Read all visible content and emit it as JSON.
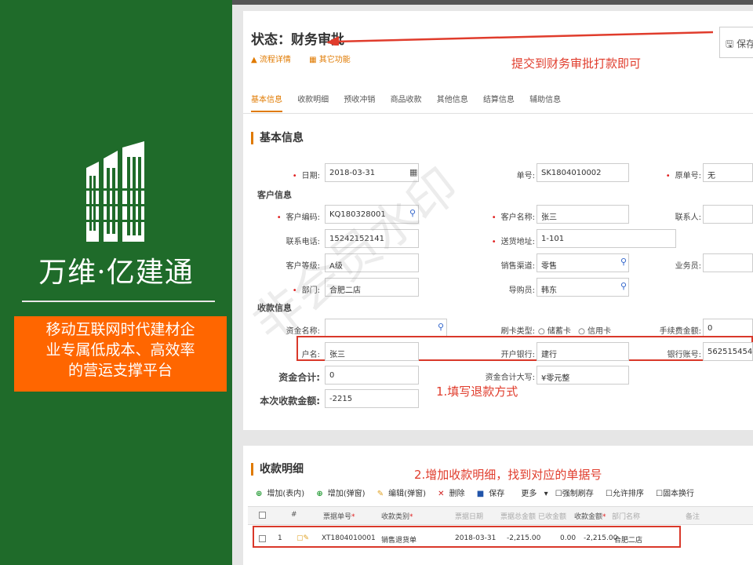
{
  "slide": {
    "brand_title": "万维·亿建通",
    "tagline_lines": [
      "移动互联网时代建材企",
      "业专属低成本、高效率",
      "的营运支撑平台"
    ],
    "watermark": "非会员水印"
  },
  "form": {
    "status_title": "状态：财务审批",
    "links": [
      "流程详情",
      "其它功能"
    ],
    "save_label": "保存",
    "tabs": [
      "基本信息",
      "收款明细",
      "预收冲销",
      "商品收款",
      "其他信息",
      "结算信息",
      "辅助信息"
    ],
    "section_basic": "基本信息",
    "group_customer": "客户信息",
    "group_payment": "收款信息",
    "fields": {
      "date": {
        "label": "日期:",
        "value": "2018-03-31"
      },
      "order_no": {
        "label": "单号:",
        "value": "SK1804010002"
      },
      "orig_no": {
        "label": "原单号:",
        "value": "无"
      },
      "cust_code": {
        "label": "客户编码:",
        "value": "KQ180328001"
      },
      "cust_name": {
        "label": "客户名称:",
        "value": "张三"
      },
      "contact": {
        "label": "联系人:",
        "value": ""
      },
      "phone": {
        "label": "联系电话:",
        "value": "15242152141"
      },
      "address": {
        "label": "送货地址:",
        "value": "1-101"
      },
      "level": {
        "label": "客户等级:",
        "value": "A级"
      },
      "channel": {
        "label": "销售渠道:",
        "value": "零售"
      },
      "salesman": {
        "label": "业务员:",
        "value": ""
      },
      "dept": {
        "label": "部门:",
        "value": "合肥二店"
      },
      "guide": {
        "label": "导购员:",
        "value": "韩东"
      },
      "fund_name": {
        "label": "资金名称:",
        "value": ""
      },
      "card_type": {
        "label": "刷卡类型:",
        "options": [
          "储蓄卡",
          "信用卡"
        ]
      },
      "fee": {
        "label": "手续费金额:",
        "value": "0"
      },
      "account_name": {
        "label": "户名:",
        "value": "张三"
      },
      "bank": {
        "label": "开户银行:",
        "value": "建行"
      },
      "account_no": {
        "label": "银行账号:",
        "value": "5625154545"
      },
      "fund_total": {
        "label": "资金合计:",
        "value": "0"
      },
      "fund_total_upper": {
        "label": "资金合计大写:",
        "value": "¥零元整"
      },
      "amount": {
        "label": "本次收款金额:",
        "value": "-2215"
      }
    },
    "annotations": {
      "submit": "提交到财务审批打款即可",
      "refund": "1.填写退款方式",
      "detail": "2.增加收款明细，找到对应的单据号"
    },
    "section_detail": "收款明细",
    "toolbar": [
      "增加(表内)",
      "增加(弹窗)",
      "编辑(弹窗)",
      "删除",
      "保存",
      "更多",
      "强制刷存",
      "允许排序",
      "固本换行"
    ],
    "table": {
      "headers": [
        "#",
        "票据单号",
        "收款类别",
        "票据日期",
        "票据总金额",
        "已收金额",
        "收款金额",
        "部门名称",
        "备注"
      ],
      "rows": [
        {
          "idx": "1",
          "bill_no": "XT1804010001",
          "category": "销售退货单",
          "date": "2018-03-31",
          "total": "-2,215.00",
          "received": "0.00",
          "amount": "-2,215.00",
          "dept": "合肥二店",
          "note": ""
        }
      ]
    }
  },
  "colors": {
    "panel_green": "#1f6b2a",
    "tagline_orange": "#ff6600",
    "accent_orange": "#e07a00",
    "annotation_red": "#d9382a"
  }
}
